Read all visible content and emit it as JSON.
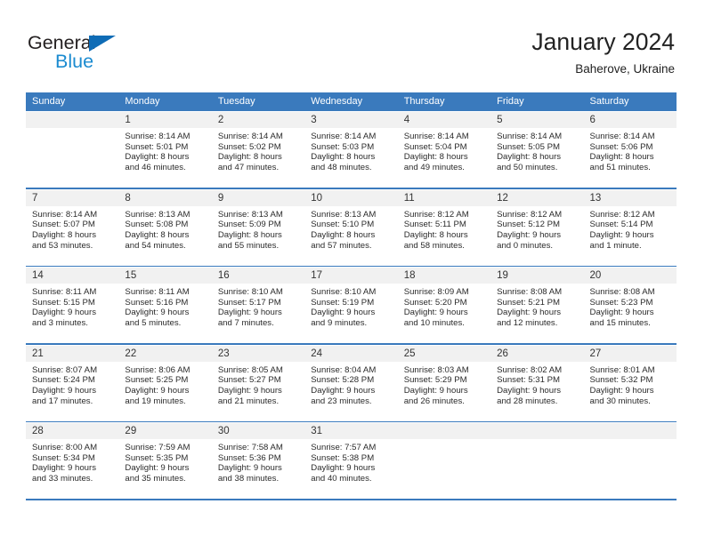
{
  "brand": {
    "name_dark": "General",
    "name_blue": "Blue",
    "accent_color": "#1b8bd0",
    "triangle_color": "#0f6cb6"
  },
  "header": {
    "title": "January 2024",
    "location": "Baherove, Ukraine",
    "header_bg": "#3a7abd",
    "daynum_bg": "#f1f1f1"
  },
  "weekday_headers": [
    "Sunday",
    "Monday",
    "Tuesday",
    "Wednesday",
    "Thursday",
    "Friday",
    "Saturday"
  ],
  "weeks": [
    {
      "days": [
        {
          "num": "",
          "sunrise": "",
          "sunset": "",
          "daylight1": "",
          "daylight2": ""
        },
        {
          "num": "1",
          "sunrise": "Sunrise: 8:14 AM",
          "sunset": "Sunset: 5:01 PM",
          "daylight1": "Daylight: 8 hours",
          "daylight2": "and 46 minutes."
        },
        {
          "num": "2",
          "sunrise": "Sunrise: 8:14 AM",
          "sunset": "Sunset: 5:02 PM",
          "daylight1": "Daylight: 8 hours",
          "daylight2": "and 47 minutes."
        },
        {
          "num": "3",
          "sunrise": "Sunrise: 8:14 AM",
          "sunset": "Sunset: 5:03 PM",
          "daylight1": "Daylight: 8 hours",
          "daylight2": "and 48 minutes."
        },
        {
          "num": "4",
          "sunrise": "Sunrise: 8:14 AM",
          "sunset": "Sunset: 5:04 PM",
          "daylight1": "Daylight: 8 hours",
          "daylight2": "and 49 minutes."
        },
        {
          "num": "5",
          "sunrise": "Sunrise: 8:14 AM",
          "sunset": "Sunset: 5:05 PM",
          "daylight1": "Daylight: 8 hours",
          "daylight2": "and 50 minutes."
        },
        {
          "num": "6",
          "sunrise": "Sunrise: 8:14 AM",
          "sunset": "Sunset: 5:06 PM",
          "daylight1": "Daylight: 8 hours",
          "daylight2": "and 51 minutes."
        }
      ]
    },
    {
      "days": [
        {
          "num": "7",
          "sunrise": "Sunrise: 8:14 AM",
          "sunset": "Sunset: 5:07 PM",
          "daylight1": "Daylight: 8 hours",
          "daylight2": "and 53 minutes."
        },
        {
          "num": "8",
          "sunrise": "Sunrise: 8:13 AM",
          "sunset": "Sunset: 5:08 PM",
          "daylight1": "Daylight: 8 hours",
          "daylight2": "and 54 minutes."
        },
        {
          "num": "9",
          "sunrise": "Sunrise: 8:13 AM",
          "sunset": "Sunset: 5:09 PM",
          "daylight1": "Daylight: 8 hours",
          "daylight2": "and 55 minutes."
        },
        {
          "num": "10",
          "sunrise": "Sunrise: 8:13 AM",
          "sunset": "Sunset: 5:10 PM",
          "daylight1": "Daylight: 8 hours",
          "daylight2": "and 57 minutes."
        },
        {
          "num": "11",
          "sunrise": "Sunrise: 8:12 AM",
          "sunset": "Sunset: 5:11 PM",
          "daylight1": "Daylight: 8 hours",
          "daylight2": "and 58 minutes."
        },
        {
          "num": "12",
          "sunrise": "Sunrise: 8:12 AM",
          "sunset": "Sunset: 5:12 PM",
          "daylight1": "Daylight: 9 hours",
          "daylight2": "and 0 minutes."
        },
        {
          "num": "13",
          "sunrise": "Sunrise: 8:12 AM",
          "sunset": "Sunset: 5:14 PM",
          "daylight1": "Daylight: 9 hours",
          "daylight2": "and 1 minute."
        }
      ]
    },
    {
      "days": [
        {
          "num": "14",
          "sunrise": "Sunrise: 8:11 AM",
          "sunset": "Sunset: 5:15 PM",
          "daylight1": "Daylight: 9 hours",
          "daylight2": "and 3 minutes."
        },
        {
          "num": "15",
          "sunrise": "Sunrise: 8:11 AM",
          "sunset": "Sunset: 5:16 PM",
          "daylight1": "Daylight: 9 hours",
          "daylight2": "and 5 minutes."
        },
        {
          "num": "16",
          "sunrise": "Sunrise: 8:10 AM",
          "sunset": "Sunset: 5:17 PM",
          "daylight1": "Daylight: 9 hours",
          "daylight2": "and 7 minutes."
        },
        {
          "num": "17",
          "sunrise": "Sunrise: 8:10 AM",
          "sunset": "Sunset: 5:19 PM",
          "daylight1": "Daylight: 9 hours",
          "daylight2": "and 9 minutes."
        },
        {
          "num": "18",
          "sunrise": "Sunrise: 8:09 AM",
          "sunset": "Sunset: 5:20 PM",
          "daylight1": "Daylight: 9 hours",
          "daylight2": "and 10 minutes."
        },
        {
          "num": "19",
          "sunrise": "Sunrise: 8:08 AM",
          "sunset": "Sunset: 5:21 PM",
          "daylight1": "Daylight: 9 hours",
          "daylight2": "and 12 minutes."
        },
        {
          "num": "20",
          "sunrise": "Sunrise: 8:08 AM",
          "sunset": "Sunset: 5:23 PM",
          "daylight1": "Daylight: 9 hours",
          "daylight2": "and 15 minutes."
        }
      ]
    },
    {
      "days": [
        {
          "num": "21",
          "sunrise": "Sunrise: 8:07 AM",
          "sunset": "Sunset: 5:24 PM",
          "daylight1": "Daylight: 9 hours",
          "daylight2": "and 17 minutes."
        },
        {
          "num": "22",
          "sunrise": "Sunrise: 8:06 AM",
          "sunset": "Sunset: 5:25 PM",
          "daylight1": "Daylight: 9 hours",
          "daylight2": "and 19 minutes."
        },
        {
          "num": "23",
          "sunrise": "Sunrise: 8:05 AM",
          "sunset": "Sunset: 5:27 PM",
          "daylight1": "Daylight: 9 hours",
          "daylight2": "and 21 minutes."
        },
        {
          "num": "24",
          "sunrise": "Sunrise: 8:04 AM",
          "sunset": "Sunset: 5:28 PM",
          "daylight1": "Daylight: 9 hours",
          "daylight2": "and 23 minutes."
        },
        {
          "num": "25",
          "sunrise": "Sunrise: 8:03 AM",
          "sunset": "Sunset: 5:29 PM",
          "daylight1": "Daylight: 9 hours",
          "daylight2": "and 26 minutes."
        },
        {
          "num": "26",
          "sunrise": "Sunrise: 8:02 AM",
          "sunset": "Sunset: 5:31 PM",
          "daylight1": "Daylight: 9 hours",
          "daylight2": "and 28 minutes."
        },
        {
          "num": "27",
          "sunrise": "Sunrise: 8:01 AM",
          "sunset": "Sunset: 5:32 PM",
          "daylight1": "Daylight: 9 hours",
          "daylight2": "and 30 minutes."
        }
      ]
    },
    {
      "days": [
        {
          "num": "28",
          "sunrise": "Sunrise: 8:00 AM",
          "sunset": "Sunset: 5:34 PM",
          "daylight1": "Daylight: 9 hours",
          "daylight2": "and 33 minutes."
        },
        {
          "num": "29",
          "sunrise": "Sunrise: 7:59 AM",
          "sunset": "Sunset: 5:35 PM",
          "daylight1": "Daylight: 9 hours",
          "daylight2": "and 35 minutes."
        },
        {
          "num": "30",
          "sunrise": "Sunrise: 7:58 AM",
          "sunset": "Sunset: 5:36 PM",
          "daylight1": "Daylight: 9 hours",
          "daylight2": "and 38 minutes."
        },
        {
          "num": "31",
          "sunrise": "Sunrise: 7:57 AM",
          "sunset": "Sunset: 5:38 PM",
          "daylight1": "Daylight: 9 hours",
          "daylight2": "and 40 minutes."
        },
        {
          "num": "",
          "sunrise": "",
          "sunset": "",
          "daylight1": "",
          "daylight2": ""
        },
        {
          "num": "",
          "sunrise": "",
          "sunset": "",
          "daylight1": "",
          "daylight2": ""
        },
        {
          "num": "",
          "sunrise": "",
          "sunset": "",
          "daylight1": "",
          "daylight2": ""
        }
      ]
    }
  ]
}
